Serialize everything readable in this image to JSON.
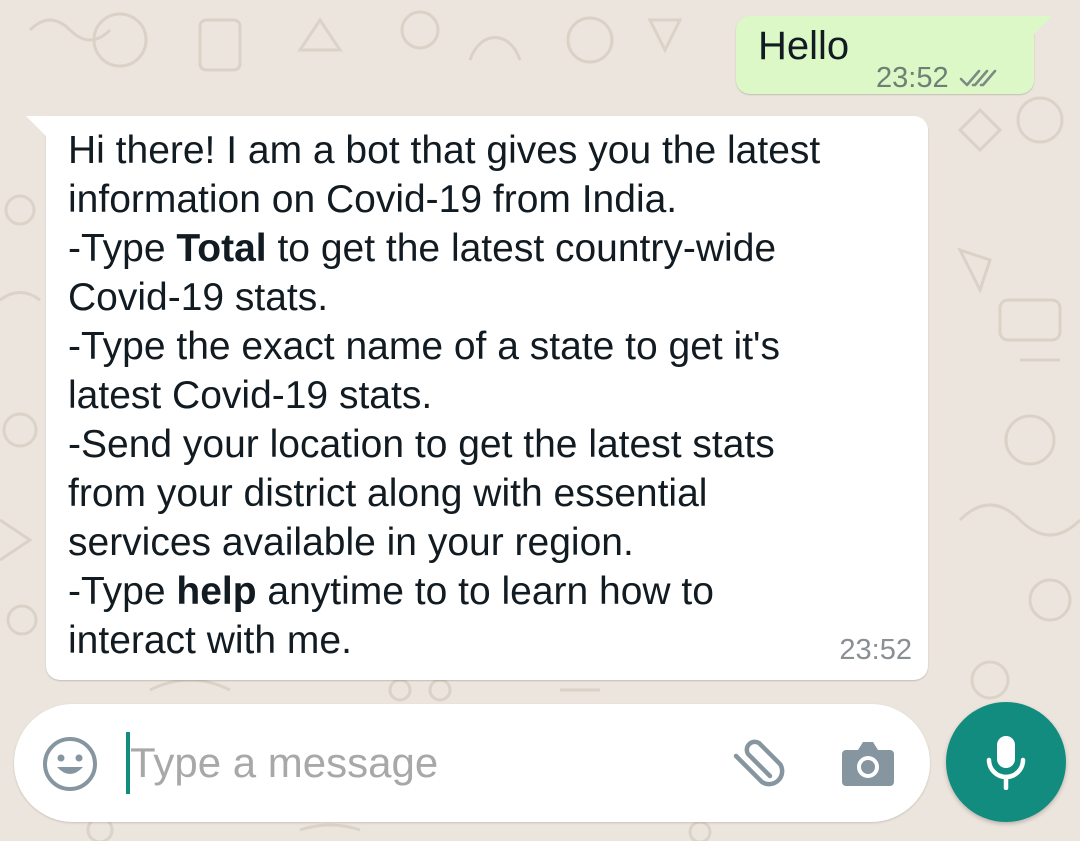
{
  "conversation": {
    "outgoing": {
      "text": "Hello",
      "time": "23:52",
      "status_icon": "double-check-icon"
    },
    "incoming": {
      "lines": [
        [
          "Hi there! I am a bot that gives you the latest"
        ],
        [
          "information on Covid-19 from India."
        ],
        [
          "-Type ",
          "Total",
          " to get the latest country-wide"
        ],
        [
          "Covid-19 stats."
        ],
        [
          "-Type the exact name of a state to get it's"
        ],
        [
          "latest Covid-19 stats."
        ],
        [
          "-Send your location to get the latest stats"
        ],
        [
          "from your district along with essential"
        ],
        [
          "services available in your region."
        ],
        [
          "-Type ",
          "help",
          " anytime to to learn how to"
        ],
        [
          "interact with me."
        ]
      ],
      "time": "23:52"
    }
  },
  "composer": {
    "placeholder": "Type a message",
    "value": "",
    "icons": {
      "emoji": "emoji-icon",
      "attach": "paperclip-icon",
      "camera": "camera-icon",
      "mic": "microphone-icon"
    }
  },
  "colors": {
    "outgoing_bubble": "#dcf8c6",
    "incoming_bubble": "#ffffff",
    "accent": "#128c7e",
    "background": "#ece5dd"
  }
}
